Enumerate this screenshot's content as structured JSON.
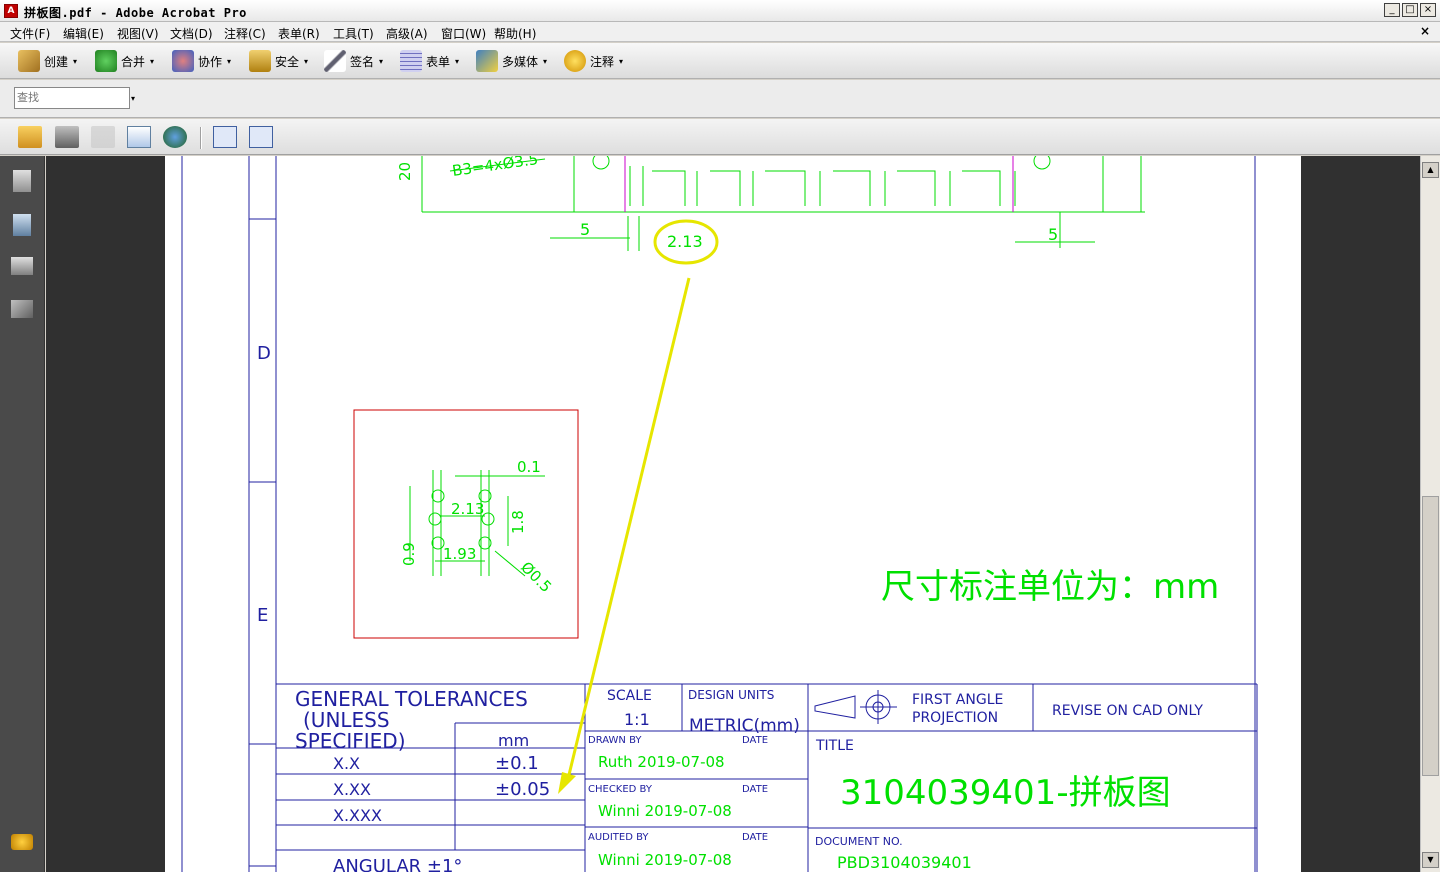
{
  "window": {
    "title": "拼板图.pdf - Adobe Acrobat Pro",
    "controls": [
      "_",
      "□",
      "×"
    ]
  },
  "menubar": {
    "items": [
      "文件(F)",
      "编辑(E)",
      "视图(V)",
      "文档(D)",
      "注释(C)",
      "表单(R)",
      "工具(T)",
      "高级(A)",
      "窗口(W)",
      "帮助(H)"
    ],
    "close": "×"
  },
  "toolbar1": {
    "buttons": [
      {
        "label": "创建",
        "icon": "create-icon"
      },
      {
        "label": "合并",
        "icon": "combine-icon"
      },
      {
        "label": "协作",
        "icon": "collaborate-icon"
      },
      {
        "label": "安全",
        "icon": "lock-icon"
      },
      {
        "label": "签名",
        "icon": "pen-icon"
      },
      {
        "label": "表单",
        "icon": "form-icon"
      },
      {
        "label": "多媒体",
        "icon": "multimedia-icon"
      },
      {
        "label": "注释",
        "icon": "comment-icon"
      }
    ],
    "dropdown_glyph": "▾"
  },
  "search": {
    "placeholder": "查找",
    "dropdown_glyph": "▾"
  },
  "toolbar3": {
    "icons": [
      "open-folder-icon",
      "print-icon",
      "save-icon",
      "email-icon",
      "web-upload-icon",
      "fit-width-icon",
      "fit-page-icon"
    ]
  },
  "navpane": {
    "icons": [
      "pages-icon",
      "bookmarks-icon",
      "layers-icon",
      "signatures-icon",
      "comments-icon"
    ]
  },
  "drawing": {
    "top_labels": {
      "hole_note": "B3=4xØ3.5",
      "left_dim": "5",
      "right_dim": "5",
      "highlighted_dim": "2.13",
      "vertical_dim": "20"
    },
    "zone_labels": [
      "D",
      "E"
    ],
    "detail": {
      "d1": "0.1",
      "d2": "2.13",
      "d3": "1.8",
      "d4": "0.9",
      "d5": "1.93",
      "d6": "Ø0.5"
    },
    "unit_note": "尺寸标注单位为：mm",
    "title_block": {
      "general_tolerances": [
        "GENERAL  TOLERANCES",
        "(UNLESS",
        "SPECIFIED)"
      ],
      "unit_header": "mm",
      "tolerance_rows": [
        {
          "format": "X.X",
          "value": "±0.1"
        },
        {
          "format": "X.XX",
          "value": "±0.05"
        },
        {
          "format": "X.XXX",
          "value": ""
        }
      ],
      "angular": "ANGULAR  ±1°",
      "scale_label": "SCALE",
      "scale_value": "1:1",
      "design_units_label": "DESIGN UNITS",
      "design_units_value": "METRIC(mm)",
      "projection": [
        "FIRST  ANGLE",
        "PROJECTION"
      ],
      "revise_note": "REVISE  ON  CAD  ONLY",
      "drawn_by_label": "DRAWN BY",
      "drawn_by_value": "Ruth  2019-07-08",
      "checked_by_label": "CHECKED BY",
      "checked_by_value": "Winni  2019-07-08",
      "audited_by_label": "AUDITED BY",
      "audited_by_value": "Winni  2019-07-08",
      "date_label": "DATE",
      "title_label": "TITLE",
      "title_value": "3104039401-拼板图",
      "document_no_label": "DOCUMENT NO.",
      "document_no_value": "PBD3104039401"
    }
  },
  "colors": {
    "cad_green": "#00dd00",
    "border_blue": "#2020a0",
    "highlight_yellow": "#e6e600",
    "detail_box_red": "#cc0000",
    "magenta": "#cc00cc"
  }
}
